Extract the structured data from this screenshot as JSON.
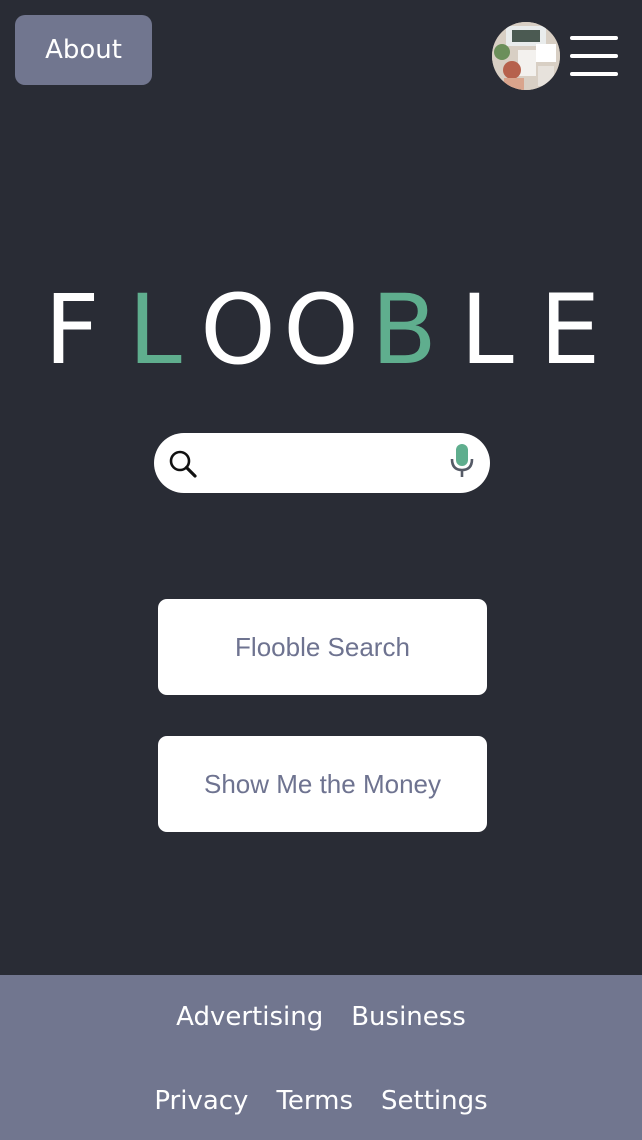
{
  "header": {
    "about_label": "About",
    "avatar_icon": "user-avatar",
    "menu_icon": "hamburger-menu-icon"
  },
  "logo": {
    "letters": [
      "F",
      "L",
      "O",
      "O",
      "B",
      "L",
      "E"
    ],
    "accent_color": "#5fae8e",
    "base_color": "#ffffff"
  },
  "search": {
    "placeholder": "",
    "value": "",
    "search_icon": "search-icon",
    "mic_icon": "microphone-icon"
  },
  "buttons": {
    "search_label": "Flooble Search",
    "money_label": "Show Me the Money"
  },
  "footer": {
    "row1": [
      "Advertising",
      "Business"
    ],
    "row2": [
      "Privacy",
      "Terms",
      "Settings"
    ]
  },
  "colors": {
    "background": "#292c35",
    "footer_background": "#71768f",
    "button_text": "#6e7390",
    "accent": "#5fae8e"
  }
}
